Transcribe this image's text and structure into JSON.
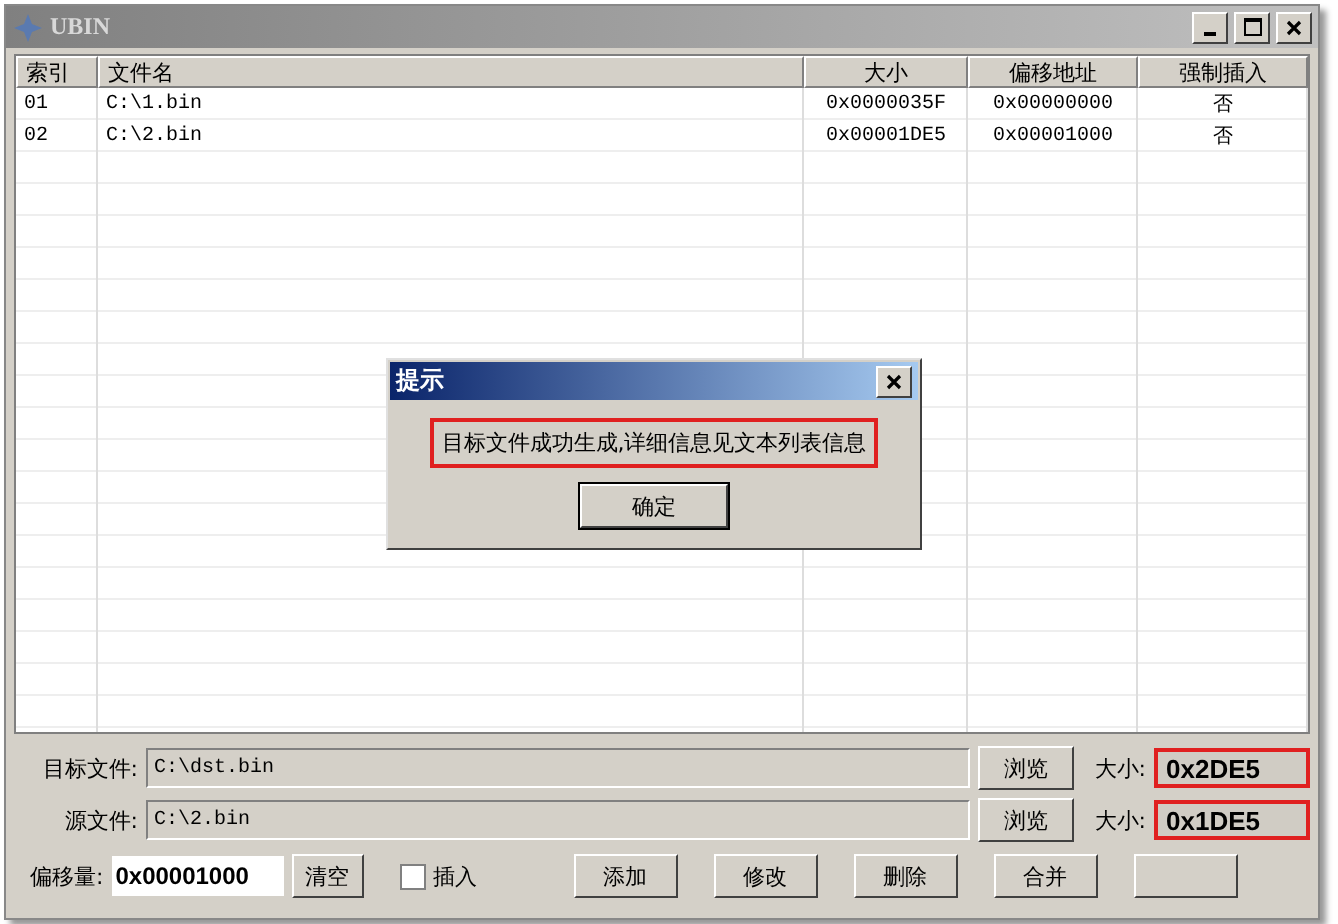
{
  "window": {
    "title": "UBIN"
  },
  "table": {
    "columns": [
      "索引",
      "文件名",
      "大小",
      "偏移地址",
      "强制插入"
    ],
    "rows": [
      {
        "cells": [
          "01",
          "C:\\1.bin",
          "0x0000035F",
          "0x00000000",
          "否"
        ]
      },
      {
        "cells": [
          "02",
          "C:\\2.bin",
          "0x00001DE5",
          "0x00001000",
          "否"
        ]
      }
    ]
  },
  "dialog": {
    "title": "提示",
    "message": "目标文件成功生成,详细信息见文本列表信息",
    "highlighted": true,
    "ok": "确定"
  },
  "target": {
    "label": "目标文件:",
    "value": "C:\\dst.bin",
    "browse": "浏览",
    "size_label": "大小:",
    "size": "0x2DE5",
    "highlighted": true
  },
  "source": {
    "label": "源文件:",
    "value": "C:\\2.bin",
    "browse": "浏览",
    "size_label": "大小:",
    "size": "0x1DE5",
    "highlighted": true
  },
  "offset": {
    "label": "偏移量:",
    "value": "0x00001000",
    "clear": "清空"
  },
  "insert": {
    "label": "插入",
    "checked": false
  },
  "buttons": [
    "添加",
    "修改",
    "删除",
    "合并"
  ]
}
